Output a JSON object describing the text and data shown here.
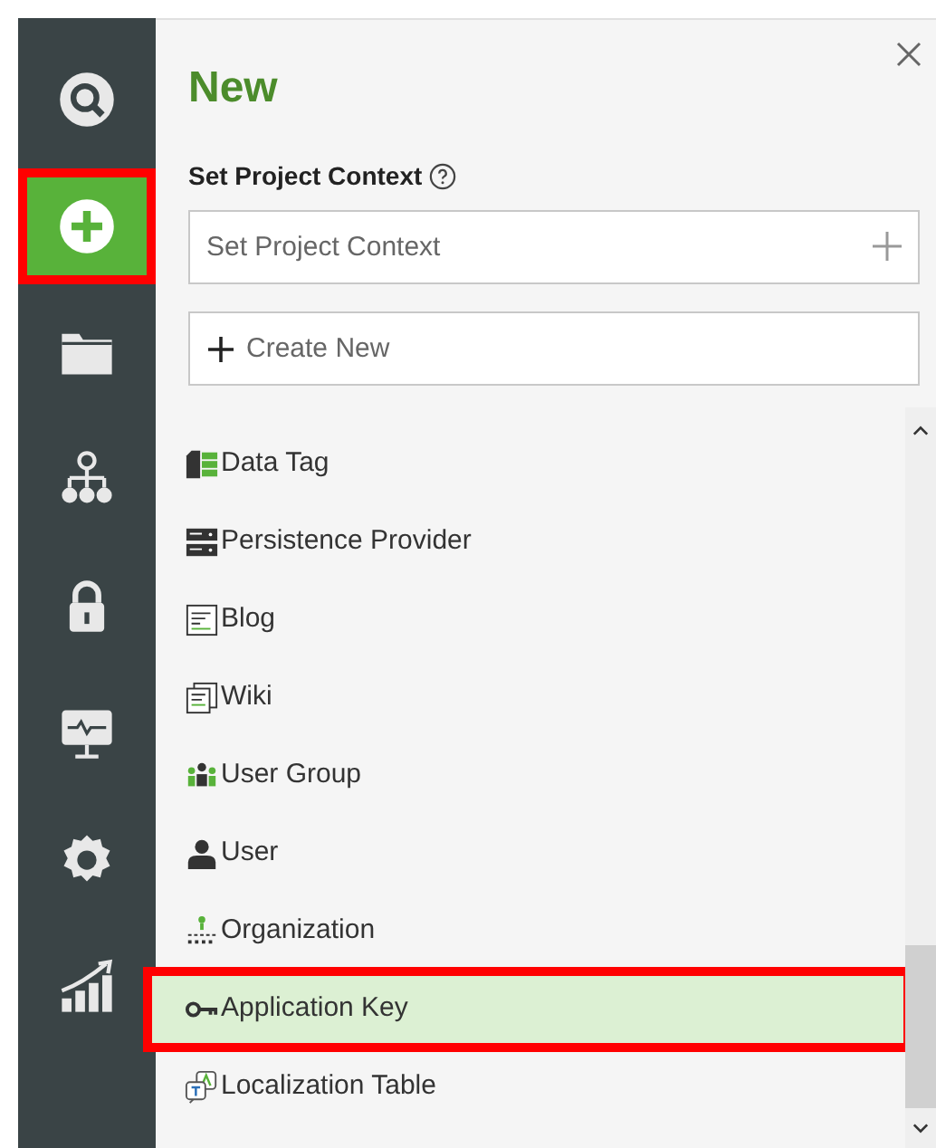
{
  "sidebar": {
    "items": [
      {
        "selected": false
      },
      {
        "selected": true
      },
      {
        "selected": false
      },
      {
        "selected": false
      },
      {
        "selected": false
      },
      {
        "selected": false
      },
      {
        "selected": false
      },
      {
        "selected": false
      }
    ]
  },
  "panel": {
    "title": "New",
    "context_label": "Set Project Context",
    "context_field": {
      "placeholder": "Set Project Context"
    },
    "create_new": {
      "placeholder": "Create New"
    },
    "items": [
      {
        "label": "Data Tag",
        "selected": false
      },
      {
        "label": "Persistence Provider",
        "selected": false
      },
      {
        "label": "Blog",
        "selected": false
      },
      {
        "label": "Wiki",
        "selected": false
      },
      {
        "label": "User Group",
        "selected": false
      },
      {
        "label": "User",
        "selected": false
      },
      {
        "label": "Organization",
        "selected": false
      },
      {
        "label": "Application Key",
        "selected": true
      },
      {
        "label": "Localization Table",
        "selected": false
      }
    ]
  }
}
